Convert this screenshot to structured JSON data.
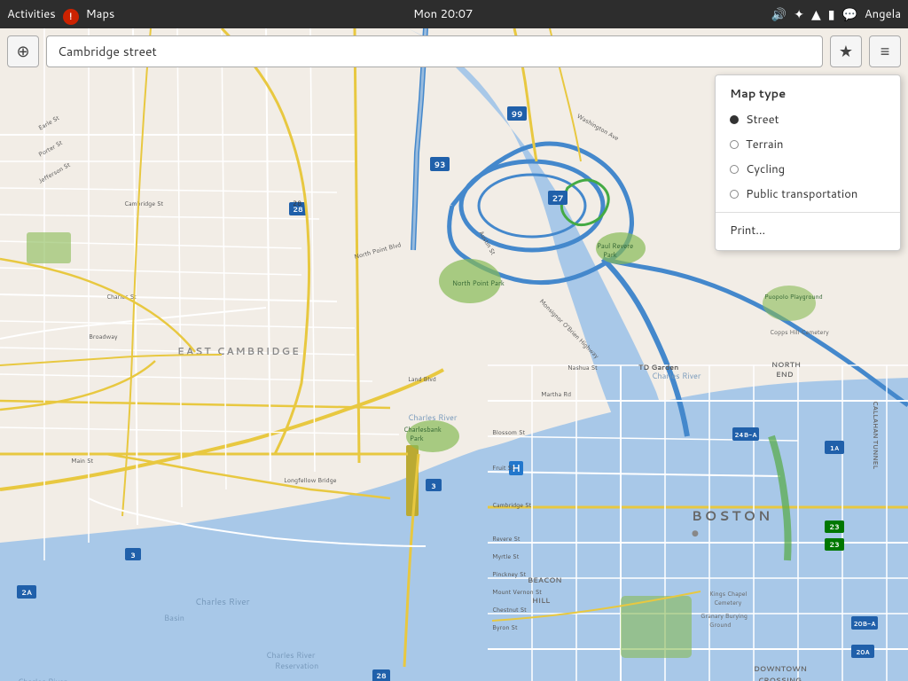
{
  "topbar": {
    "activities_label": "Activities",
    "app_name": "Maps",
    "clock": "Mon 20:07",
    "user": "Angela",
    "icons": {
      "sound": "🔊",
      "bluetooth": "✦",
      "wifi": "📶",
      "battery": "🔋",
      "message": "💬"
    }
  },
  "toolbar": {
    "locate_icon": "⊕",
    "search_value": "Cambridge street",
    "star_icon": "★",
    "menu_icon": "≡"
  },
  "map_type_panel": {
    "title": "Map type",
    "options": [
      {
        "label": "Street",
        "selected": true
      },
      {
        "label": "Terrain",
        "selected": false
      },
      {
        "label": "Cycling",
        "selected": false
      },
      {
        "label": "Public transportation",
        "selected": false
      }
    ],
    "print_label": "Print..."
  },
  "map": {
    "center_label": "Charles River",
    "district_label": "EAST CAMBRIDGE",
    "city_label": "BOSTON",
    "basin_label": "Charles River Basin",
    "reservation_label": "Charles River Reservation",
    "park1": "North Point Park",
    "park2": "Charlesbank Park",
    "park3": "Paul Revere Park",
    "park4": "Puopolo Playground"
  }
}
